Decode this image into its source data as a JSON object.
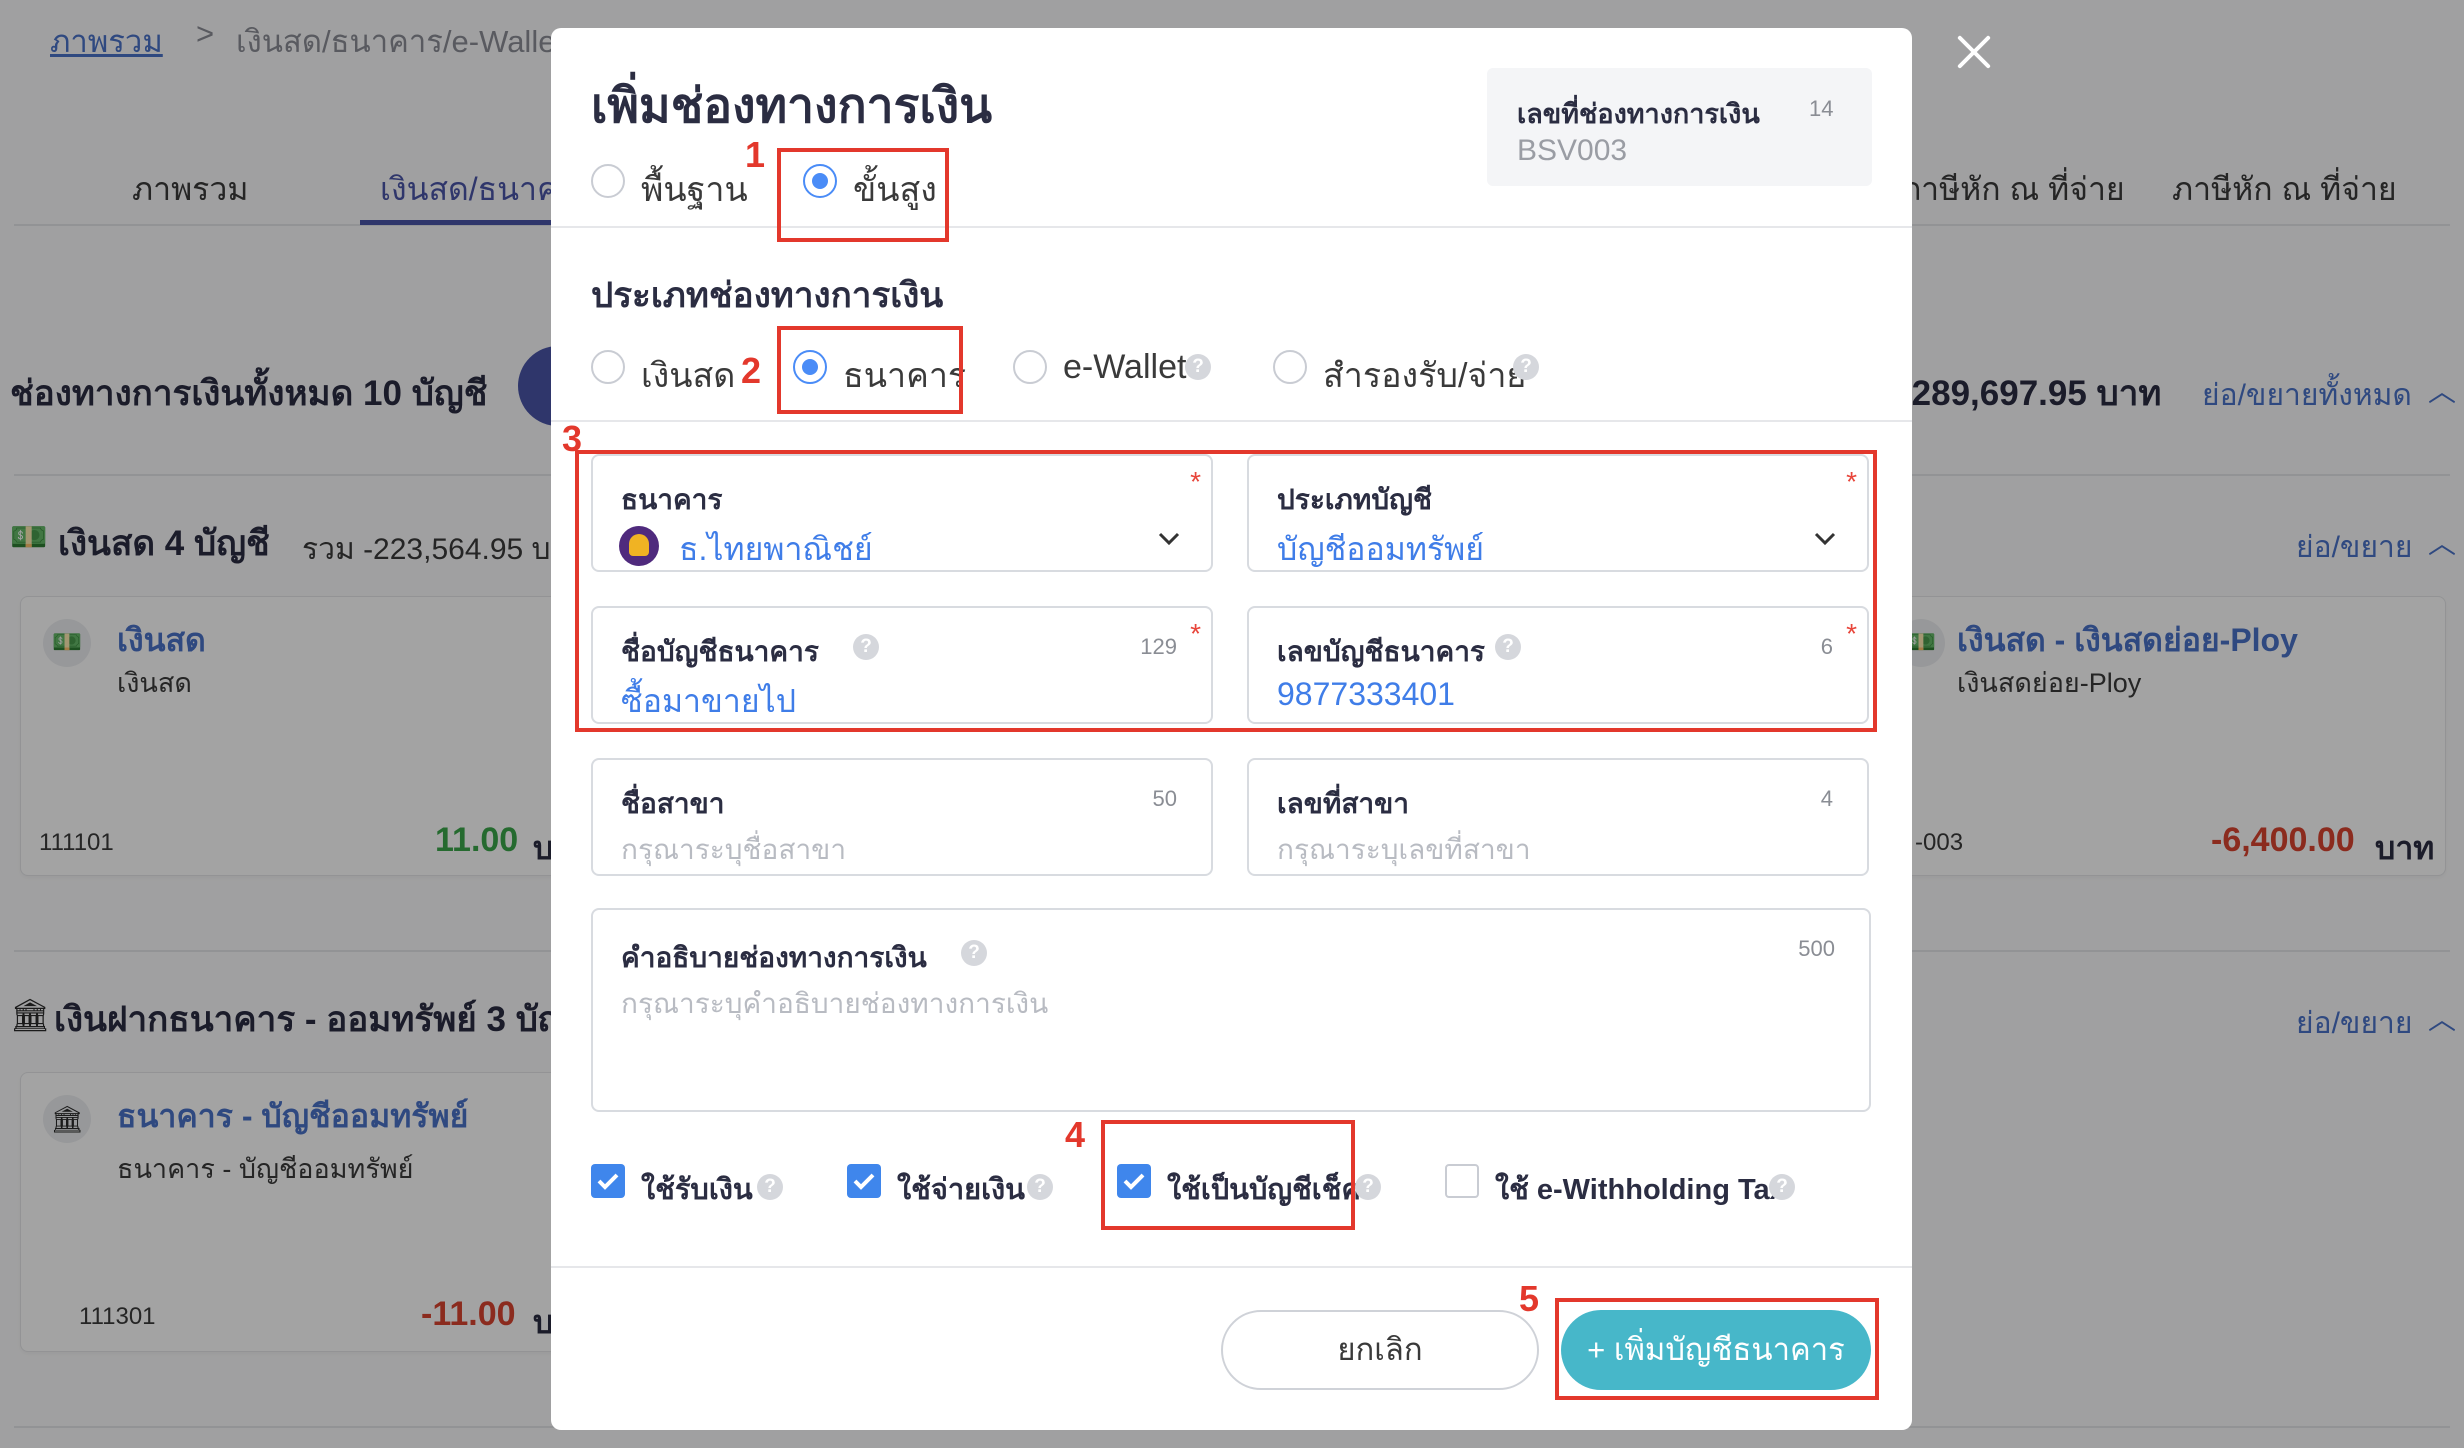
{
  "background": {
    "breadcrumb": {
      "home": "ภาพรวม",
      "separator": ">",
      "current": "เงินสด/ธนาคาร/e-Wallet"
    },
    "tabs": [
      {
        "label": "ภาพรวม"
      },
      {
        "label": "เงินสด/ธนาคาร"
      },
      {
        "label": "ภาษีหัก ณ ที่จ่าย"
      },
      {
        "label": "ภาษีหัก ณ ที่จ่าย"
      }
    ],
    "total_label": "ช่องทางการเงินทั้งหมด 10 บัญชี",
    "total_amount": "-289,697.95 บาท",
    "collapse_all": "ย่อ/ขยายทั้งหมด",
    "cash_section": {
      "title": "เงินสด 4 บัญชี",
      "sum": "รวม -223,564.95 บ",
      "toggle": "ย่อ/ขยาย"
    },
    "cash_cards": [
      {
        "name": "เงินสด",
        "sub": "เงินสด",
        "code": "111101",
        "amount": "11.00",
        "unit": "บ"
      },
      {
        "name": "เงินสด - เงินสดย่อย-Ploy",
        "sub": "เงินสดย่อย-Ploy",
        "code": "-003",
        "amount": "-6,400.00",
        "unit": "บาท"
      }
    ],
    "bank_section": {
      "title": "เงินฝากธนาคาร - ออมทรัพย์ 3 บัญ",
      "toggle": "ย่อ/ขยาย"
    },
    "bank_cards": [
      {
        "name": "ธนาคาร - บัญชีออมทรัพย์",
        "sub": "ธนาคาร - บัญชีออมทรัพย์",
        "code": "111301",
        "amount": "-11.00",
        "unit": "บ"
      }
    ]
  },
  "modal": {
    "title": "เพิ่มช่องทางการเงิน",
    "mode_options": [
      {
        "label": "พื้นฐาน",
        "selected": false
      },
      {
        "label": "ขั้นสูง",
        "selected": true
      }
    ],
    "doc_number": {
      "label": "เลขที่ช่องทางการเงิน",
      "count": "14",
      "value": "BSV003"
    },
    "type_section_title": "ประเภทช่องทางการเงิน",
    "type_options": [
      {
        "label": "เงินสด",
        "selected": false
      },
      {
        "label": "ธนาคาร",
        "selected": true
      },
      {
        "label": "e-Wallet",
        "selected": false
      },
      {
        "label": "สำรองรับ/จ่าย",
        "selected": false
      }
    ],
    "fields": {
      "bank": {
        "label": "ธนาคาร",
        "required": "*",
        "value": "ธ.ไทยพาณิชย์"
      },
      "account_type": {
        "label": "ประเภทบัญชี",
        "required": "*",
        "value": "บัญชีออมทรัพย์"
      },
      "account_name": {
        "label": "ชื่อบัญชีธนาคาร",
        "count": "129",
        "required": "*",
        "value": "ซื้อมาขายไป"
      },
      "account_number": {
        "label": "เลขบัญชีธนาคาร",
        "count": "6",
        "required": "*",
        "value": "9877333401"
      },
      "branch_name": {
        "label": "ชื่อสาขา",
        "count": "50",
        "placeholder": "กรุณาระบุชื่อสาขา"
      },
      "branch_number": {
        "label": "เลขที่สาขา",
        "count": "4",
        "placeholder": "กรุณาระบุเลขที่สาขา"
      },
      "description": {
        "label": "คำอธิบายช่องทางการเงิน",
        "count": "500",
        "placeholder": "กรุณาระบุคำอธิบายช่องทางการเงิน"
      }
    },
    "checkboxes": [
      {
        "label": "ใช้รับเงิน",
        "checked": true
      },
      {
        "label": "ใช้จ่ายเงิน",
        "checked": true
      },
      {
        "label": "ใช้เป็นบัญชีเช็ค",
        "checked": true
      },
      {
        "label": "ใช้ e-Withholding Tax",
        "checked": false
      }
    ],
    "cancel_label": "ยกเลิก",
    "submit_label": "+ เพิ่มบัญชีธนาคาร"
  },
  "annotations": [
    "1",
    "2",
    "3",
    "4",
    "5"
  ],
  "colors": {
    "highlight": "#e3382c",
    "accent": "#3f86ec",
    "submit": "#47b7c9",
    "value": "#3f7de8"
  }
}
